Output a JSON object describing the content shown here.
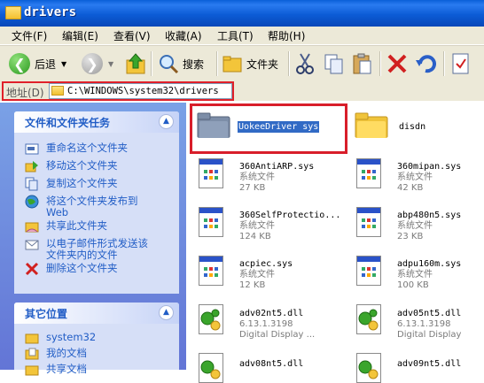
{
  "window": {
    "title": "drivers"
  },
  "menu": [
    "文件(F)",
    "编辑(E)",
    "查看(V)",
    "收藏(A)",
    "工具(T)",
    "帮助(H)"
  ],
  "toolbar": {
    "back_label": "后退",
    "search_label": "搜索",
    "folders_label": "文件夹"
  },
  "address": {
    "label": "地址(D)",
    "value": "C:\\WINDOWS\\system32\\drivers"
  },
  "tasks_panel": {
    "title": "文件和文件夹任务",
    "items": [
      {
        "label": "重命名这个文件夹",
        "icon": "rename-icon"
      },
      {
        "label": "移动这个文件夹",
        "icon": "move-icon"
      },
      {
        "label": "复制这个文件夹",
        "icon": "copy-icon"
      },
      {
        "label": "将这个文件夹发布到",
        "label2": "Web",
        "icon": "publish-web-icon"
      },
      {
        "label": "共享此文件夹",
        "icon": "share-icon"
      },
      {
        "label": "以电子邮件形式发送该",
        "label2": "文件夹内的文件",
        "icon": "email-icon"
      },
      {
        "label": "删除这个文件夹",
        "icon": "delete-icon"
      }
    ]
  },
  "places_panel": {
    "title": "其它位置",
    "items": [
      {
        "label": "system32",
        "icon": "folder-icon"
      },
      {
        "label": "我的文档",
        "icon": "my-documents-icon"
      },
      {
        "label": "共享文档",
        "icon": "shared-documents-icon"
      }
    ]
  },
  "files": [
    {
      "name": "UokeeDriver sys",
      "type": "folder",
      "selected": true
    },
    {
      "name": "disdn",
      "type": "folder"
    },
    {
      "name": "360AntiARP.sys",
      "desc": "系统文件",
      "size": "27 KB",
      "type": "sys"
    },
    {
      "name": "360mipan.sys",
      "desc": "系统文件",
      "size": "42 KB",
      "type": "sys"
    },
    {
      "name": "360SelfProtectio...",
      "desc": "系统文件",
      "size": "124 KB",
      "type": "sys"
    },
    {
      "name": "abp480n5.sys",
      "desc": "系统文件",
      "size": "23 KB",
      "type": "sys"
    },
    {
      "name": "acpiec.sys",
      "desc": "系统文件",
      "size": "12 KB",
      "type": "sys"
    },
    {
      "name": "adpu160m.sys",
      "desc": "系统文件",
      "size": "100 KB",
      "type": "sys"
    },
    {
      "name": "adv02nt5.dll",
      "desc": "6.13.1.3198",
      "size": "Digital Display ...",
      "type": "dll"
    },
    {
      "name": "adv05nt5.dll",
      "desc": "6.13.1.3198",
      "size": "Digital Display",
      "type": "dll"
    },
    {
      "name": "adv08nt5.dll",
      "type": "dll"
    },
    {
      "name": "adv09nt5.dll",
      "type": "dll"
    }
  ],
  "colors": {
    "titlebar": "#0a5fd8",
    "task_link": "#215dc6",
    "highlight": "#d81e2a",
    "selection": "#316ac5"
  }
}
